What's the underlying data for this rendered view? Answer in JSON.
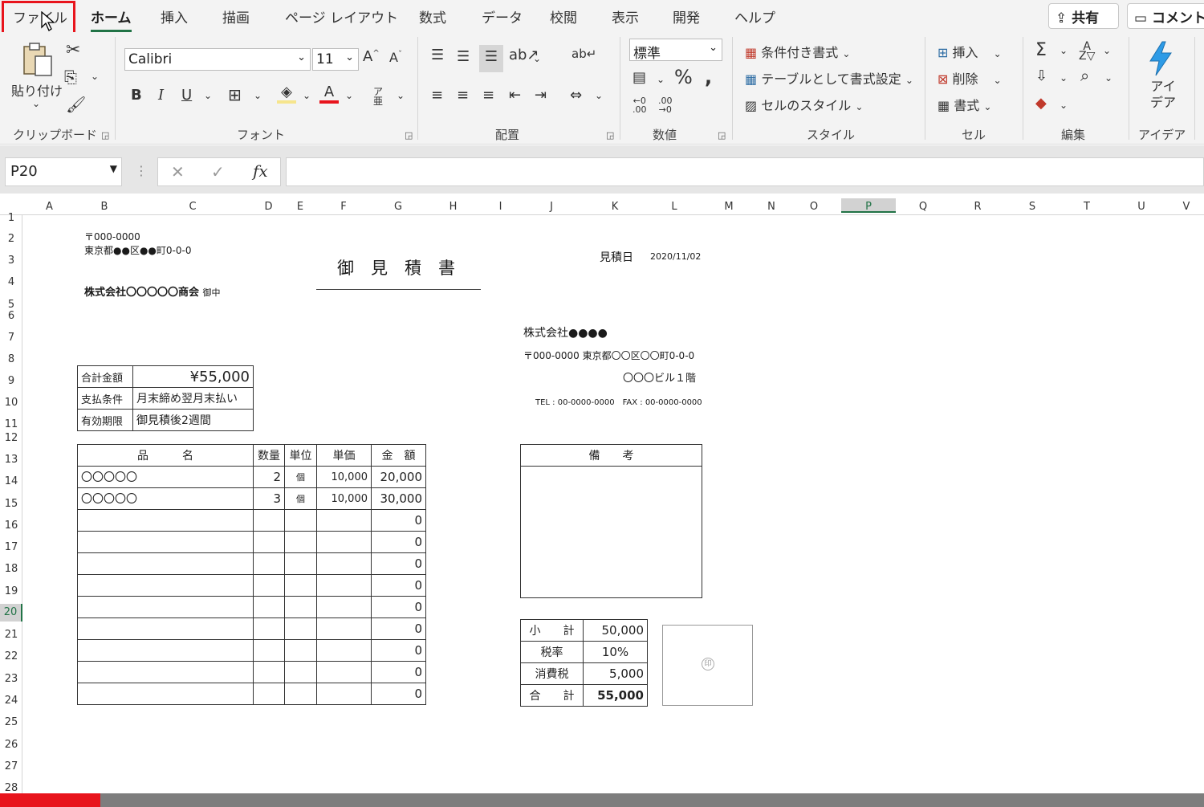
{
  "tabs": [
    "ファイル",
    "ホーム",
    "挿入",
    "描画",
    "ページ レイアウト",
    "数式",
    "データ",
    "校閲",
    "表示",
    "開発",
    "ヘルプ"
  ],
  "share_label": "共有",
  "comment_label": "コメント",
  "ribbon": {
    "clipboard": {
      "paste": "貼り付け",
      "group": "クリップボード"
    },
    "font": {
      "name": "Calibri",
      "size": "11",
      "group": "フォント"
    },
    "align": {
      "group": "配置"
    },
    "number": {
      "format": "標準",
      "group": "数値"
    },
    "styles": {
      "cond": "条件付き書式",
      "table": "テーブルとして書式設定",
      "cell": "セルのスタイル",
      "group": "スタイル"
    },
    "cells": {
      "insert": "挿入",
      "delete": "削除",
      "format": "書式",
      "group": "セル"
    },
    "edit": {
      "group": "編集"
    },
    "ideas": {
      "label1": "アイ",
      "label2": "デア",
      "group": "アイデア"
    }
  },
  "namebox": "P20",
  "columns": [
    "A",
    "B",
    "C",
    "D",
    "E",
    "F",
    "G",
    "H",
    "I",
    "J",
    "K",
    "L",
    "M",
    "N",
    "O",
    "P",
    "Q",
    "R",
    "S",
    "T",
    "U",
    "V"
  ],
  "rows": [
    "1",
    "2",
    "3",
    "4",
    "5",
    "6",
    "7",
    "8",
    "9",
    "10",
    "11",
    "12",
    "13",
    "14",
    "15",
    "16",
    "17",
    "18",
    "19",
    "20",
    "21",
    "22",
    "23",
    "24",
    "25",
    "26",
    "27",
    "28"
  ],
  "sheet": {
    "postal": "〒000-0000",
    "address": "東京都●●区●●町0-0-0",
    "title": "御　見　積　書",
    "date_label": "見積日",
    "date": "2020/11/02",
    "client": "株式会社〇〇〇〇〇商会",
    "client_suffix": "御中",
    "company": "株式会社●●●●",
    "company_addr": "〒000-0000 東京都〇〇区〇〇町0-0-0",
    "building": "〇〇〇ビル１階",
    "tel_fax": "TEL : 00-0000-0000　FAX : 00-0000-0000",
    "summary": [
      {
        "label": "合計金額",
        "value": "¥55,000"
      },
      {
        "label": "支払条件",
        "value": "月末締め翌月末払い"
      },
      {
        "label": "有効期限",
        "value": "御見積後2週間"
      }
    ],
    "items_header": {
      "name": "品　　　名",
      "qty": "数量",
      "unit": "単位",
      "price": "単価",
      "amount": "金　額"
    },
    "items": [
      {
        "name": "〇〇〇〇〇",
        "qty": "2",
        "unit": "個",
        "price": "10,000",
        "amount": "20,000"
      },
      {
        "name": "〇〇〇〇〇",
        "qty": "3",
        "unit": "個",
        "price": "10,000",
        "amount": "30,000"
      },
      {
        "name": "",
        "qty": "",
        "unit": "",
        "price": "",
        "amount": "0"
      },
      {
        "name": "",
        "qty": "",
        "unit": "",
        "price": "",
        "amount": "0"
      },
      {
        "name": "",
        "qty": "",
        "unit": "",
        "price": "",
        "amount": "0"
      },
      {
        "name": "",
        "qty": "",
        "unit": "",
        "price": "",
        "amount": "0"
      },
      {
        "name": "",
        "qty": "",
        "unit": "",
        "price": "",
        "amount": "0"
      },
      {
        "name": "",
        "qty": "",
        "unit": "",
        "price": "",
        "amount": "0"
      },
      {
        "name": "",
        "qty": "",
        "unit": "",
        "price": "",
        "amount": "0"
      },
      {
        "name": "",
        "qty": "",
        "unit": "",
        "price": "",
        "amount": "0"
      },
      {
        "name": "",
        "qty": "",
        "unit": "",
        "price": "",
        "amount": "0"
      }
    ],
    "remarks_header": "備　　考",
    "totals": [
      {
        "label": "小　　計",
        "value": "50,000"
      },
      {
        "label": "税率",
        "value": "10%"
      },
      {
        "label": "消費税",
        "value": "5,000"
      },
      {
        "label": "合　　計",
        "value": "55,000"
      }
    ],
    "seal": "印"
  }
}
